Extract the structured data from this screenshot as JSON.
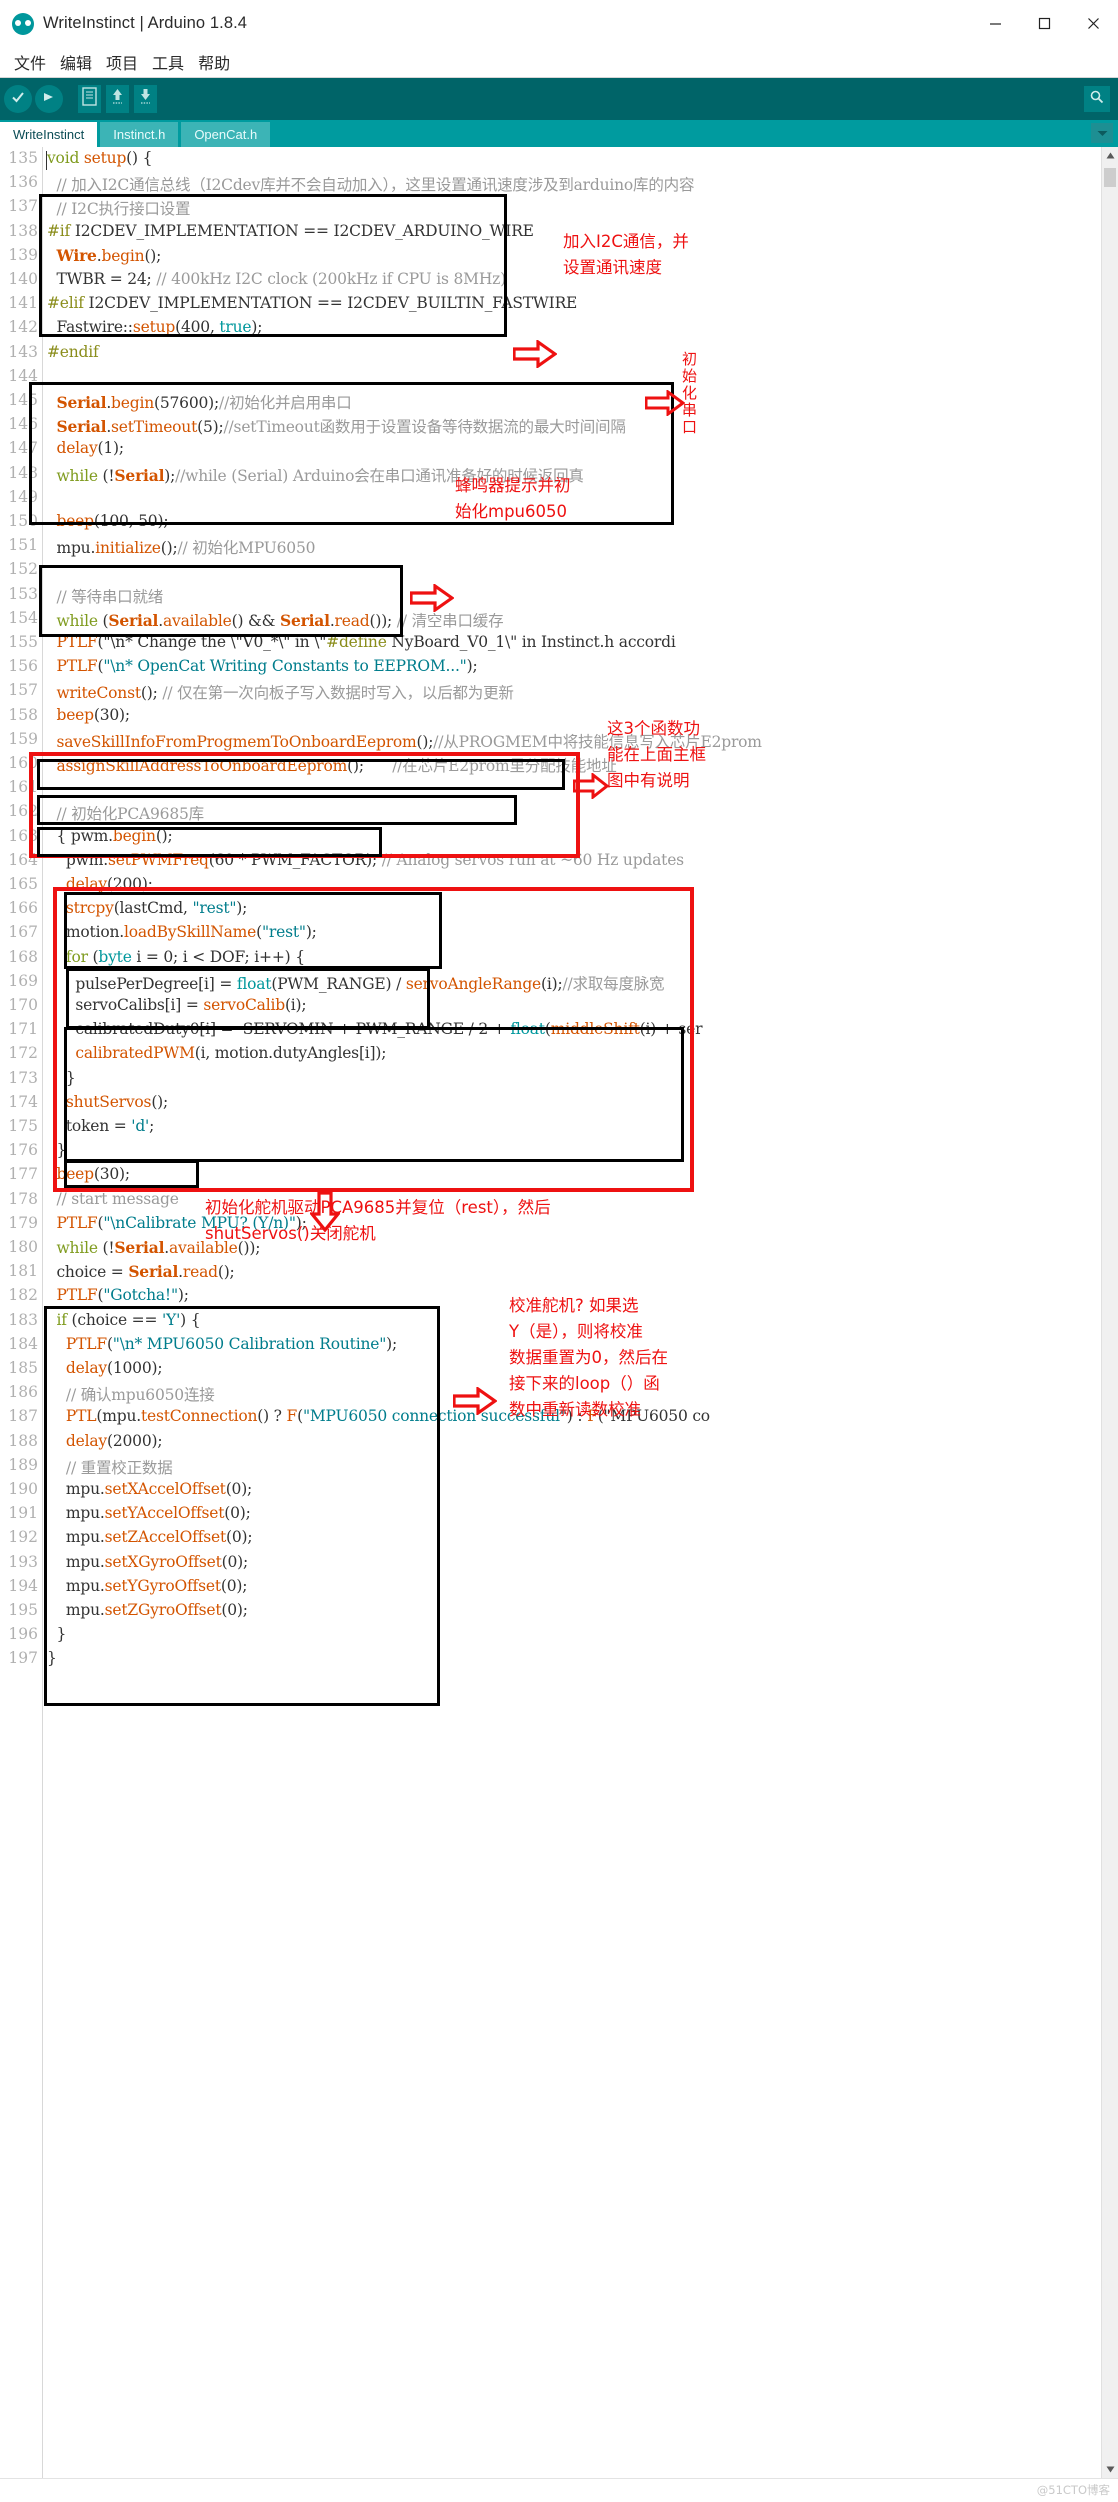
{
  "window": {
    "title": "WriteInstinct | Arduino 1.8.4",
    "logo_icon": "arduino-logo-icon",
    "minimize_icon": "minimize-icon",
    "maximize_icon": "maximize-icon",
    "close_icon": "close-icon"
  },
  "menubar": {
    "items": [
      {
        "label": "文件"
      },
      {
        "label": "编辑"
      },
      {
        "label": "项目"
      },
      {
        "label": "工具"
      },
      {
        "label": "帮助"
      }
    ]
  },
  "toolbar": {
    "background": "#006468",
    "buttons": [
      {
        "name": "verify-button",
        "icon": "check-icon"
      },
      {
        "name": "upload-button",
        "icon": "arrow-right-icon"
      },
      {
        "name": "new-button",
        "icon": "new-file-icon"
      },
      {
        "name": "open-button",
        "icon": "arrow-up-icon"
      },
      {
        "name": "save-button",
        "icon": "arrow-down-icon"
      }
    ],
    "serial_monitor": {
      "name": "serial-monitor-button",
      "icon": "magnifier-icon"
    }
  },
  "tabs": {
    "items": [
      {
        "label": "WriteInstinct",
        "active": true
      },
      {
        "label": "Instinct.h",
        "active": false
      },
      {
        "label": "OpenCat.h",
        "active": false
      }
    ],
    "menu_icon": "chevron-down-icon"
  },
  "editor": {
    "first_line": 135,
    "lines": [
      {
        "n": 135,
        "text": "void setup() {"
      },
      {
        "n": 136,
        "text": "  // 加入I2C通信总线（I2Cdev库并不会自动加入），这里设置通讯速度涉及到arduino库的内容"
      },
      {
        "n": 137,
        "text": "  // I2C执行接口设置"
      },
      {
        "n": 138,
        "text": "#if I2CDEV_IMPLEMENTATION == I2CDEV_ARDUINO_WIRE"
      },
      {
        "n": 139,
        "text": "  Wire.begin();"
      },
      {
        "n": 140,
        "text": "  TWBR = 24; // 400kHz I2C clock (200kHz if CPU is 8MHz)"
      },
      {
        "n": 141,
        "text": "#elif I2CDEV_IMPLEMENTATION == I2CDEV_BUILTIN_FASTWIRE"
      },
      {
        "n": 142,
        "text": "  Fastwire::setup(400, true);"
      },
      {
        "n": 143,
        "text": "#endif"
      },
      {
        "n": 144,
        "text": ""
      },
      {
        "n": 145,
        "text": "  Serial.begin(57600);//初始化并启用串口"
      },
      {
        "n": 146,
        "text": "  Serial.setTimeout(5);//setTimeout函数用于设置设备等待数据流的最大时间间隔"
      },
      {
        "n": 147,
        "text": "  delay(1);"
      },
      {
        "n": 148,
        "text": "  while (!Serial);//while (Serial) Arduino会在串口通讯准备好的时候返回真"
      },
      {
        "n": 149,
        "text": ""
      },
      {
        "n": 150,
        "text": "  beep(100, 50);"
      },
      {
        "n": 151,
        "text": "  mpu.initialize();// 初始化MPU6050"
      },
      {
        "n": 152,
        "text": ""
      },
      {
        "n": 153,
        "text": "  // 等待串口就绪"
      },
      {
        "n": 154,
        "text": "  while (Serial.available() && Serial.read()); // 清空串口缓存"
      },
      {
        "n": 155,
        "text": "  PTLF(\"\\n* Change the \\\"V0_*\\\" in \\\"#define NyBoard_V0_1\\\" in Instinct.h accordi"
      },
      {
        "n": 156,
        "text": "  PTLF(\"\\n* OpenCat Writing Constants to EEPROM...\");"
      },
      {
        "n": 157,
        "text": "  writeConst(); // 仅在第一次向板子写入数据时写入，以后都为更新"
      },
      {
        "n": 158,
        "text": "  beep(30);"
      },
      {
        "n": 159,
        "text": "  saveSkillInfoFromProgmemToOnboardEeprom();//从PROGMEM中将技能信息写入芯片E2prom"
      },
      {
        "n": 160,
        "text": "  assignSkillAddressToOnboardEeprom();      //在芯片E2prom里分配技能地址"
      },
      {
        "n": 161,
        "text": ""
      },
      {
        "n": 162,
        "text": "  // 初始化PCA9685库"
      },
      {
        "n": 163,
        "text": "  { pwm.begin();"
      },
      {
        "n": 164,
        "text": "    pwm.setPWMFreq(60 * PWM_FACTOR); // Analog servos run at ~60 Hz updates"
      },
      {
        "n": 165,
        "text": "    delay(200);"
      },
      {
        "n": 166,
        "text": "    strcpy(lastCmd, \"rest\");"
      },
      {
        "n": 167,
        "text": "    motion.loadBySkillName(\"rest\");"
      },
      {
        "n": 168,
        "text": "    for (byte i = 0; i < DOF; i++) {"
      },
      {
        "n": 169,
        "text": "      pulsePerDegree[i] = float(PWM_RANGE) / servoAngleRange(i);//求取每度脉宽"
      },
      {
        "n": 170,
        "text": "      servoCalibs[i] = servoCalib(i);"
      },
      {
        "n": 171,
        "text": "      calibratedDuty0[i] =  SERVOMIN + PWM_RANGE / 2 + float(middleShift(i) + ser"
      },
      {
        "n": 172,
        "text": "      calibratedPWM(i, motion.dutyAngles[i]);"
      },
      {
        "n": 173,
        "text": "    }"
      },
      {
        "n": 174,
        "text": "    shutServos();"
      },
      {
        "n": 175,
        "text": "    token = 'd';"
      },
      {
        "n": 176,
        "text": "  }"
      },
      {
        "n": 177,
        "text": "  beep(30);"
      },
      {
        "n": 178,
        "text": "  // start message"
      },
      {
        "n": 179,
        "text": "  PTLF(\"\\nCalibrate MPU? (Y/n)\");"
      },
      {
        "n": 180,
        "text": "  while (!Serial.available());"
      },
      {
        "n": 181,
        "text": "  choice = Serial.read();"
      },
      {
        "n": 182,
        "text": "  PTLF(\"Gotcha!\");"
      },
      {
        "n": 183,
        "text": "  if (choice == 'Y') {"
      },
      {
        "n": 184,
        "text": "    PTLF(\"\\n* MPU6050 Calibration Routine\");"
      },
      {
        "n": 185,
        "text": "    delay(1000);"
      },
      {
        "n": 186,
        "text": "    // 确认mpu6050连接"
      },
      {
        "n": 187,
        "text": "    PTL(mpu.testConnection() ? F(\"MPU6050 connection successful\") : F(\"MPU6050 co"
      },
      {
        "n": 188,
        "text": "    delay(2000);"
      },
      {
        "n": 189,
        "text": "    // 重置校正数据"
      },
      {
        "n": 190,
        "text": "    mpu.setXAccelOffset(0);"
      },
      {
        "n": 191,
        "text": "    mpu.setYAccelOffset(0);"
      },
      {
        "n": 192,
        "text": "    mpu.setZAccelOffset(0);"
      },
      {
        "n": 193,
        "text": "    mpu.setXGyroOffset(0);"
      },
      {
        "n": 194,
        "text": "    mpu.setYGyroOffset(0);"
      },
      {
        "n": 195,
        "text": "    mpu.setZGyroOffset(0);"
      },
      {
        "n": 196,
        "text": "  }"
      },
      {
        "n": 197,
        "text": "}"
      }
    ]
  },
  "annotations": {
    "color": "#ee1111",
    "notes": [
      {
        "id": "note-i2c",
        "text": "加入I2C通信，并\n设置通讯速度",
        "arrow": "arrow-right-icon"
      },
      {
        "id": "note-serial",
        "text": "初始化串口",
        "arrow": "arrow-right-icon",
        "vertical": true
      },
      {
        "id": "note-beep-mpu",
        "text": "蜂鸣器提示并初\n始化mpu6050",
        "arrow": "arrow-right-icon"
      },
      {
        "id": "note-three-functions",
        "text": "这3个函数功\n能在上面主框\n图中有说明",
        "arrow": "arrow-right-icon"
      },
      {
        "id": "note-pca9685",
        "text": "初始化舵机驱动PCA9685并复位（rest），然后\nshutServos()关闭舵机",
        "arrow": "arrow-down-icon"
      },
      {
        "id": "note-calibrate",
        "text": "校准舵机? 如果选\nY（是），则将校准\n数据重置为0，然后在\n接下来的loop（）函\n数中重新读数校准",
        "arrow": "arrow-right-icon"
      }
    ]
  },
  "scrollbar": {
    "up_icon": "scroll-up-icon",
    "down_icon": "scroll-down-icon",
    "thumb": "scroll-thumb"
  },
  "statusbar": {
    "watermark": "@51CTO博客"
  }
}
